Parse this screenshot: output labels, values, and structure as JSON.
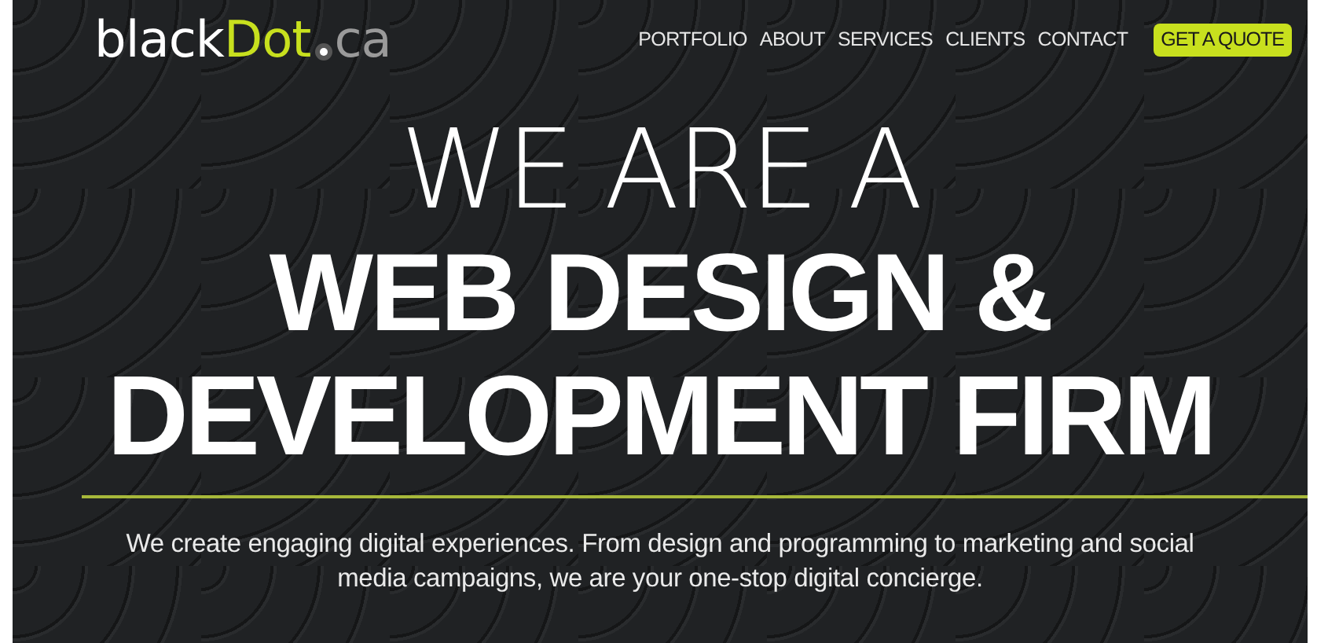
{
  "logo": {
    "parts": [
      "black",
      "Dot",
      "ca"
    ]
  },
  "nav": [
    {
      "label": "PORTFOLIO",
      "kind": "link"
    },
    {
      "label": "ABOUT",
      "kind": "link"
    },
    {
      "label": "SERVICES",
      "kind": "link"
    },
    {
      "label": "CLIENTS",
      "kind": "link"
    },
    {
      "label": "CONTACT",
      "kind": "link"
    },
    {
      "label": "GET A QUOTE",
      "kind": "cta"
    }
  ],
  "headline": [
    {
      "text": "WE ARE A",
      "kind": "light"
    },
    {
      "text": "WEB DESIGN &",
      "kind": "bold"
    },
    {
      "text": "DEVELOPMENT FIRM",
      "kind": "bold"
    }
  ],
  "tagline": "We create engaging digital experiences. From design and programming to marketing and social media campaigns, we are your one-stop digital concierge."
}
